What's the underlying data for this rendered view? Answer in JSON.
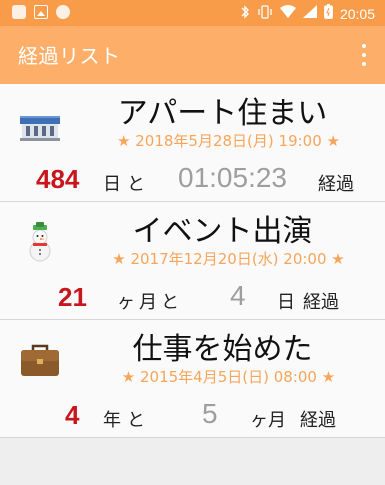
{
  "status_bar": {
    "time": "20:05"
  },
  "app_bar": {
    "title": "経過リスト"
  },
  "items": [
    {
      "icon": "station-building-icon",
      "title": "アパート住まい",
      "date": "★ 2018年5月28日(月) 19:00 ★",
      "primary_value": "484",
      "primary_unit": "日と",
      "secondary_value": "01:05:23",
      "suffix": "経過"
    },
    {
      "icon": "snowman-icon",
      "title": "イベント出演",
      "date": "★ 2017年12月20日(水) 20:00 ★",
      "primary_value": "21",
      "primary_unit": "ヶ月と",
      "secondary_value": "4",
      "secondary_unit": "日",
      "suffix": "経過"
    },
    {
      "icon": "briefcase-icon",
      "title": "仕事を始めた",
      "date": "★ 2015年4月5日(日) 08:00 ★",
      "primary_value": "4",
      "primary_unit": "年と",
      "secondary_value": "5",
      "secondary_unit": "ヶ月",
      "suffix": "経過"
    }
  ],
  "colors": {
    "status_bar": "#f89c4a",
    "app_bar": "#fdae69",
    "accent_red": "#c8161d",
    "date_orange": "#f7a55a"
  }
}
